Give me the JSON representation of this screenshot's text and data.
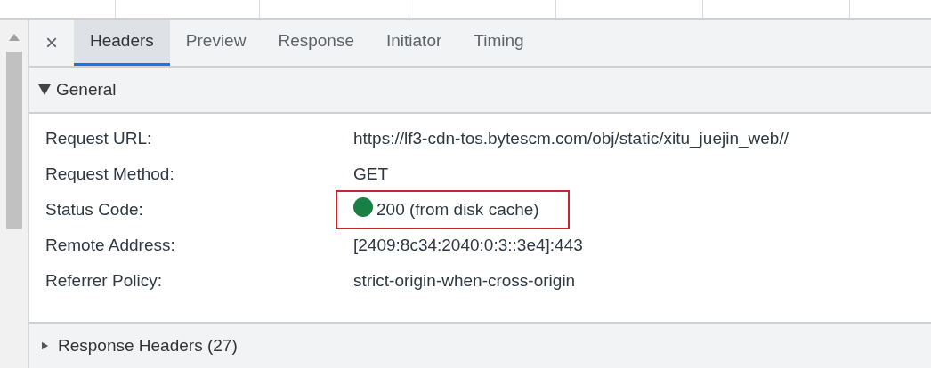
{
  "tabs": [
    {
      "label": "Headers",
      "selected": true
    },
    {
      "label": "Preview",
      "selected": false
    },
    {
      "label": "Response",
      "selected": false
    },
    {
      "label": "Initiator",
      "selected": false
    },
    {
      "label": "Timing",
      "selected": false
    }
  ],
  "close_symbol": "×",
  "sections": [
    {
      "title": "General",
      "expanded": true,
      "rows": [
        {
          "label": "Request URL:",
          "value": "https://lf3-cdn-tos.bytescm.com/obj/static/xitu_juejin_web//",
          "kind": "text",
          "highlighted": false
        },
        {
          "label": "Request Method:",
          "value": "GET",
          "kind": "text",
          "highlighted": false
        },
        {
          "label": "Status Code:",
          "value": "200 (from disk cache)",
          "kind": "status",
          "color": "#1a7f45",
          "highlighted": true
        },
        {
          "label": "Remote Address:",
          "value": "[2409:8c34:2040:0:3::3e4]:443",
          "kind": "text",
          "highlighted": false
        },
        {
          "label": "Referrer Policy:",
          "value": "strict-origin-when-cross-origin",
          "kind": "text",
          "highlighted": false
        }
      ]
    },
    {
      "title": "Response Headers (27)",
      "expanded": false
    }
  ]
}
